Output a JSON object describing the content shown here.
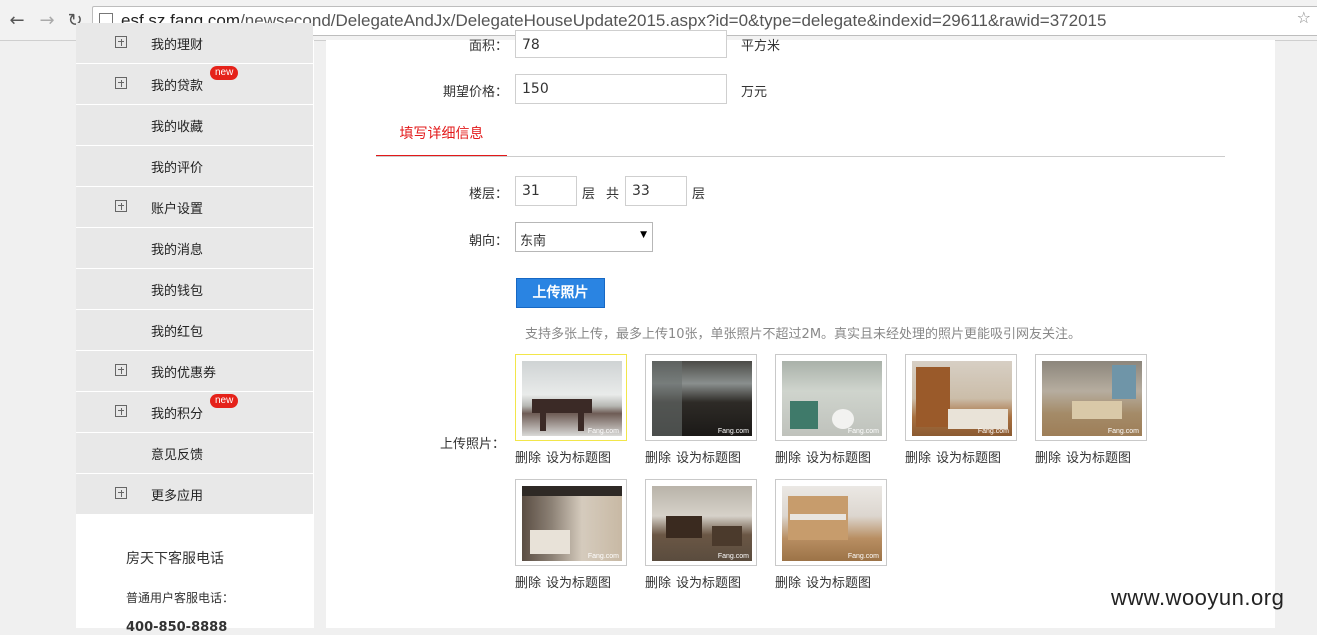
{
  "browser": {
    "url_host": "esf.sz.fang.com",
    "url_path": "/newsecond/DelegateAndJx/DelegateHouseUpdate2015.aspx?id=0&type=delegate&indexid=29611&rawid=372015"
  },
  "sidebar": {
    "items": [
      {
        "label": "我的理财",
        "expandable": true,
        "badge": ""
      },
      {
        "label": "我的贷款",
        "expandable": true,
        "badge": "new"
      },
      {
        "label": "我的收藏",
        "expandable": false,
        "badge": ""
      },
      {
        "label": "我的评价",
        "expandable": false,
        "badge": ""
      },
      {
        "label": "账户设置",
        "expandable": true,
        "badge": ""
      },
      {
        "label": "我的消息",
        "expandable": false,
        "badge": ""
      },
      {
        "label": "我的钱包",
        "expandable": false,
        "badge": ""
      },
      {
        "label": "我的红包",
        "expandable": false,
        "badge": ""
      },
      {
        "label": "我的优惠券",
        "expandable": true,
        "badge": ""
      },
      {
        "label": "我的积分",
        "expandable": true,
        "badge": "new"
      },
      {
        "label": "意见反馈",
        "expandable": false,
        "badge": ""
      },
      {
        "label": "更多应用",
        "expandable": true,
        "badge": ""
      }
    ],
    "help_title": "房天下客服电话",
    "help_sub": "普通用户客服电话：",
    "help_phone": "400-850-8888"
  },
  "form": {
    "area_label": "面积：",
    "area_value": "78",
    "area_unit": "平方米",
    "price_label": "期望价格：",
    "price_value": "150",
    "price_unit": "万元",
    "tab_label": "填写详细信息",
    "floor_label": "楼层：",
    "floor_value": "31",
    "floor_unit": "层",
    "total_label": "共",
    "total_value": "33",
    "total_unit": "层",
    "orient_label": "朝向：",
    "orient_value": "东南",
    "upload_button": "上传照片",
    "upload_tip": "支持多张上传，最多上传10张，单张照片不超过2M。真实且未经处理的照片更能吸引网友关注。",
    "upload_label": "上传照片：",
    "photo_delete": "删除",
    "photo_set_cover": "设为标题图",
    "photo_count": 8
  },
  "watermark": "www.wooyun.org",
  "colors": {
    "accent_red": "#e3191a",
    "button_blue": "#2a84e2",
    "sidebar_bg": "#e8e8e8"
  }
}
